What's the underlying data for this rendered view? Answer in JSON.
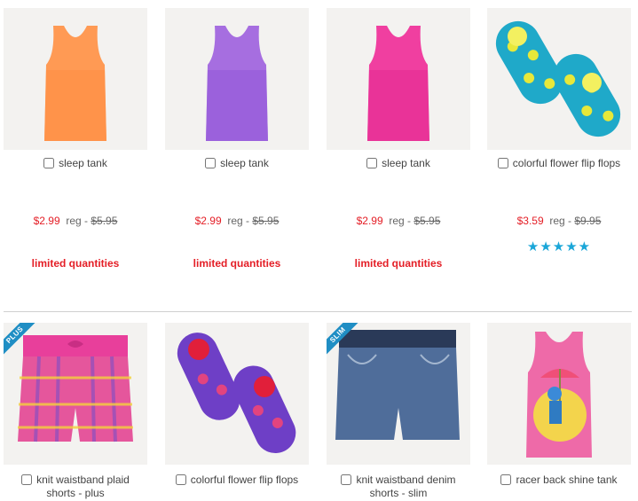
{
  "products": [
    {
      "name": "sleep tank",
      "sale": "$2.99",
      "reg_label": "reg - ",
      "was": "$5.95",
      "note": "limited quantities",
      "color": "#ff9a54"
    },
    {
      "name": "sleep tank",
      "sale": "$2.99",
      "reg_label": "reg - ",
      "was": "$5.95",
      "note": "limited quantities",
      "color": "#a66ee0"
    },
    {
      "name": "sleep tank",
      "sale": "$2.99",
      "reg_label": "reg - ",
      "was": "$5.95",
      "note": "limited quantities",
      "color": "#f03fa0"
    },
    {
      "name": "colorful flower flip flops",
      "sale": "$3.59",
      "reg_label": "reg - ",
      "was": "$9.95",
      "stars": "★★★★★",
      "rating": 5
    },
    {
      "name": "knit waistband plaid shorts - plus",
      "name_line1": "knit waistband plaid",
      "name_line2": "shorts - plus",
      "badge": "PLUS"
    },
    {
      "name": "colorful flower flip flops"
    },
    {
      "name": "knit waistband denim shorts - slim",
      "name_line1": "knit waistband denim",
      "name_line2": "shorts - slim",
      "badge": "SLIM"
    },
    {
      "name": "racer back shine tank"
    }
  ]
}
